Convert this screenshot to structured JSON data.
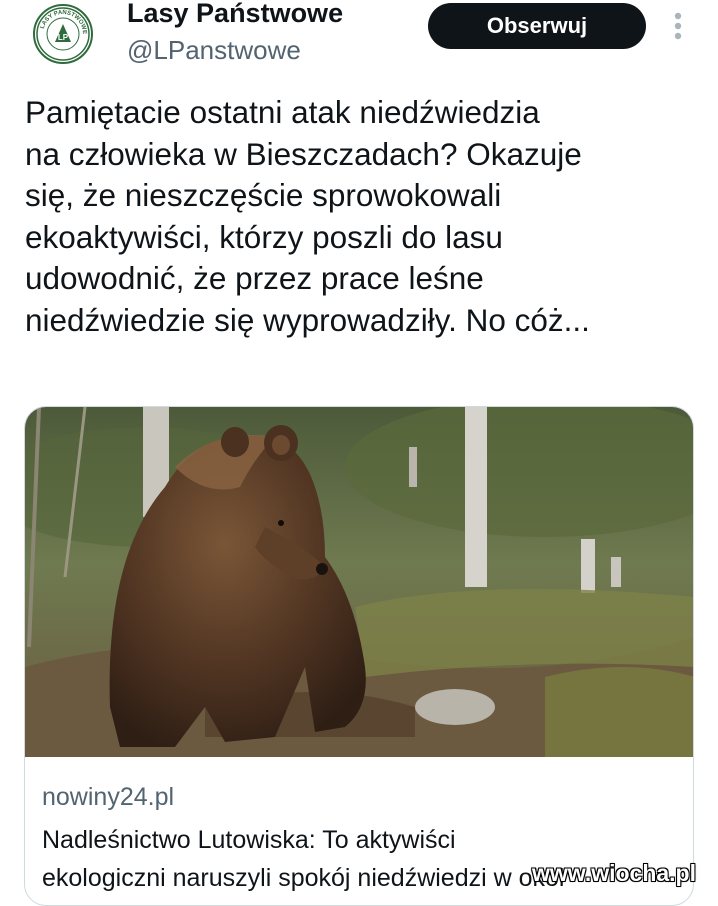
{
  "account": {
    "display_name": "Lasy Państwowe",
    "handle": "@LPanstwowe",
    "avatar_text": "LASY PAŃSTWOWE",
    "avatar_logo": "LP"
  },
  "follow_button": {
    "label": "Obserwuj"
  },
  "more_icon": "more-vertical-icon",
  "tweet": {
    "lines": [
      "Pamiętacie ostatni atak niedźwiedzia",
      "na człowieka w Bieszczadach? Okazuje",
      "się, że nieszczęście sprowokowali",
      "ekoaktywiści, którzy poszli do lasu",
      "udowodnić, że przez prace leśne",
      "niedźwiedzie się wyprowadziły. No cóż..."
    ]
  },
  "link_card": {
    "domain": "nowiny24.pl",
    "title_lines": [
      "Nadleśnictwo Lutowiska: To aktywiści",
      "ekologiczni naruszyli spokój niedźwiedzi w okol"
    ]
  },
  "watermark": "www.wiocha.pl",
  "colors": {
    "text": "#0f1419",
    "secondary": "#536471",
    "button_bg": "#0f1419",
    "card_border": "#cfd9de",
    "logo_green": "#2f6b3d"
  }
}
